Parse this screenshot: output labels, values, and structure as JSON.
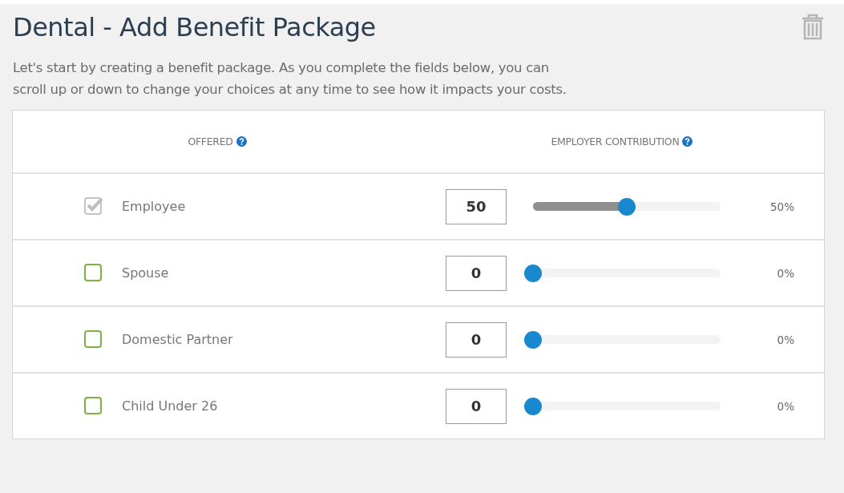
{
  "title": "Dental - Add Benefit Package",
  "intro": "Let's start by creating a benefit package. As you complete the fields below, you can scroll up or down to change your choices at any time to see how it impacts your costs.",
  "table": {
    "columns": [
      "OFFERED",
      "EMPLOYER CONTRIBUTION"
    ],
    "rows": [
      {
        "label": "Employee",
        "checked": true,
        "disabled": true,
        "value": "50",
        "level": 0.5,
        "reading": "50%"
      },
      {
        "label": "Spouse",
        "checked": false,
        "disabled": false,
        "value": "0",
        "level": 0,
        "reading": "0%"
      },
      {
        "label": "Domestic Partner",
        "checked": false,
        "disabled": false,
        "value": "0",
        "level": 0,
        "reading": "0%"
      },
      {
        "label": "Child Under 26",
        "checked": false,
        "disabled": false,
        "value": "0",
        "level": 0,
        "reading": "0%"
      }
    ]
  }
}
